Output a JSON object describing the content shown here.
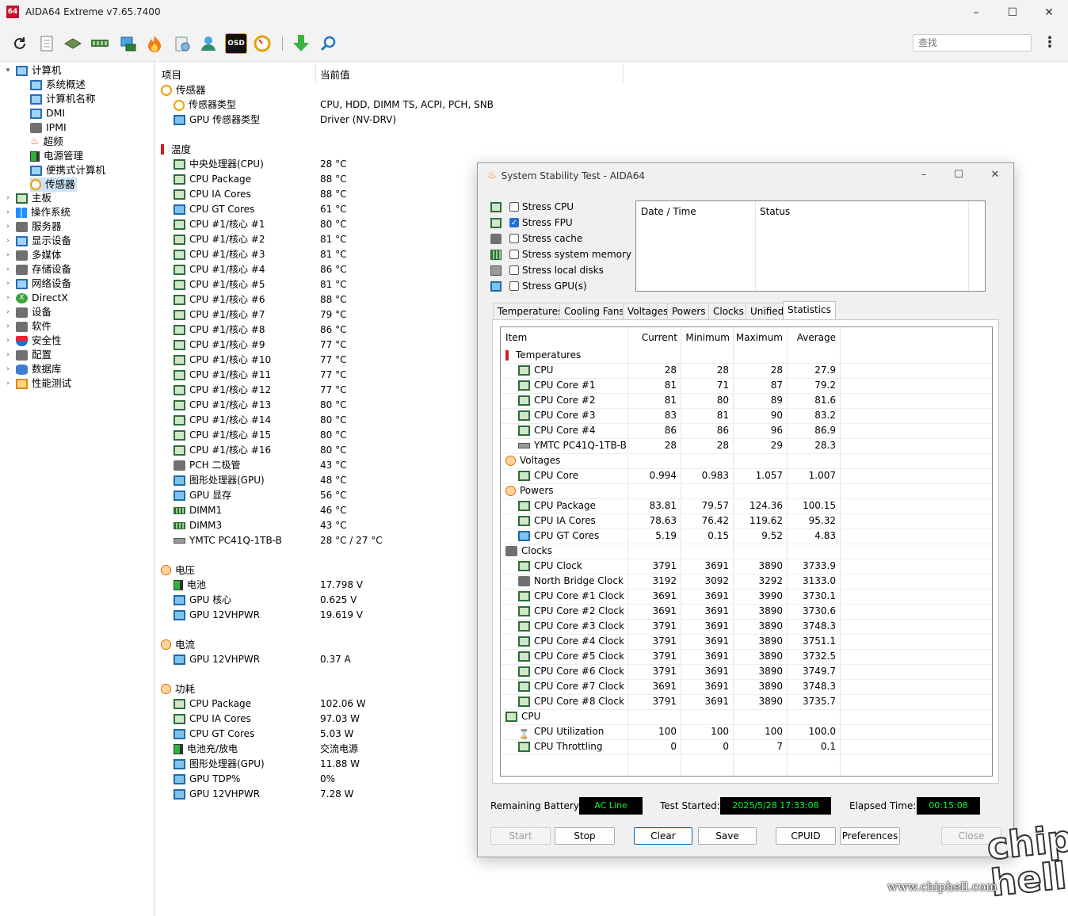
{
  "window": {
    "title": "AIDA64 Extreme v7.65.7400",
    "logo": "64",
    "minimize": "–",
    "maximize": "☐",
    "close": "✕"
  },
  "toolbar": {
    "search_placeholder": "查找",
    "more": "⋮",
    "osd": "OSD"
  },
  "sidebar": {
    "items": [
      {
        "label": "计算机",
        "expanded": true
      },
      {
        "label": "系统概述"
      },
      {
        "label": "计算机名称"
      },
      {
        "label": "DMI"
      },
      {
        "label": "IPMI"
      },
      {
        "label": "超频"
      },
      {
        "label": "电源管理"
      },
      {
        "label": "便携式计算机"
      },
      {
        "label": "传感器",
        "selected": true
      },
      {
        "label": "主板"
      },
      {
        "label": "操作系统"
      },
      {
        "label": "服务器"
      },
      {
        "label": "显示设备"
      },
      {
        "label": "多媒体"
      },
      {
        "label": "存储设备"
      },
      {
        "label": "网络设备"
      },
      {
        "label": "DirectX"
      },
      {
        "label": "设备"
      },
      {
        "label": "软件"
      },
      {
        "label": "安全性"
      },
      {
        "label": "配置"
      },
      {
        "label": "数据库"
      },
      {
        "label": "性能测试"
      }
    ]
  },
  "main": {
    "col_item": "项目",
    "col_value": "当前值",
    "rows": [
      {
        "type": "group",
        "label": "传感器",
        "icon": "gauge"
      },
      {
        "label": "传感器类型",
        "value": "CPU, HDD, DIMM TS, ACPI, PCH, SNB",
        "icon": "gauge"
      },
      {
        "label": "GPU 传感器类型",
        "value": "Driver  (NV-DRV)",
        "icon": "gpu"
      },
      {
        "type": "gap"
      },
      {
        "type": "group",
        "label": "温度",
        "icon": "therm"
      },
      {
        "label": "中央处理器(CPU)",
        "value": "28 °C",
        "icon": "chip"
      },
      {
        "label": "CPU Package",
        "value": "88 °C",
        "icon": "chip"
      },
      {
        "label": "CPU IA Cores",
        "value": "88 °C",
        "icon": "chip"
      },
      {
        "label": "CPU GT Cores",
        "value": "61 °C",
        "icon": "gpu"
      },
      {
        "label": "CPU #1/核心 #1",
        "value": "80 °C",
        "icon": "chip"
      },
      {
        "label": "CPU #1/核心 #2",
        "value": "81 °C",
        "icon": "chip"
      },
      {
        "label": "CPU #1/核心 #3",
        "value": "81 °C",
        "icon": "chip"
      },
      {
        "label": "CPU #1/核心 #4",
        "value": "86 °C",
        "icon": "chip"
      },
      {
        "label": "CPU #1/核心 #5",
        "value": "81 °C",
        "icon": "chip"
      },
      {
        "label": "CPU #1/核心 #6",
        "value": "88 °C",
        "icon": "chip"
      },
      {
        "label": "CPU #1/核心 #7",
        "value": "79 °C",
        "icon": "chip"
      },
      {
        "label": "CPU #1/核心 #8",
        "value": "86 °C",
        "icon": "chip"
      },
      {
        "label": "CPU #1/核心 #9",
        "value": "77 °C",
        "icon": "chip"
      },
      {
        "label": "CPU #1/核心 #10",
        "value": "77 °C",
        "icon": "chip"
      },
      {
        "label": "CPU #1/核心 #11",
        "value": "77 °C",
        "icon": "chip"
      },
      {
        "label": "CPU #1/核心 #12",
        "value": "77 °C",
        "icon": "chip"
      },
      {
        "label": "CPU #1/核心 #13",
        "value": "80 °C",
        "icon": "chip"
      },
      {
        "label": "CPU #1/核心 #14",
        "value": "80 °C",
        "icon": "chip"
      },
      {
        "label": "CPU #1/核心 #15",
        "value": "80 °C",
        "icon": "chip"
      },
      {
        "label": "CPU #1/核心 #16",
        "value": "80 °C",
        "icon": "chip"
      },
      {
        "label": "PCH 二极管",
        "value": "43 °C",
        "icon": "gray"
      },
      {
        "label": "图形处理器(GPU)",
        "value": "48 °C",
        "icon": "gpu"
      },
      {
        "label": "GPU 显存",
        "value": "56 °C",
        "icon": "gpu"
      },
      {
        "label": "DIMM1",
        "value": "46 °C",
        "icon": "dimm"
      },
      {
        "label": "DIMM3",
        "value": "43 °C",
        "icon": "dimm"
      },
      {
        "label": "YMTC PC41Q-1TB-B",
        "value": "28 °C / 27 °C",
        "icon": "disk"
      },
      {
        "type": "gap"
      },
      {
        "type": "group",
        "label": "电压",
        "icon": "bolt"
      },
      {
        "label": "电池",
        "value": "17.798 V",
        "icon": "bat"
      },
      {
        "label": "GPU 核心",
        "value": "0.625 V",
        "icon": "gpu"
      },
      {
        "label": "GPU 12VHPWR",
        "value": "19.619 V",
        "icon": "gpu"
      },
      {
        "type": "gap"
      },
      {
        "type": "group",
        "label": "电流",
        "icon": "bolt"
      },
      {
        "label": "GPU 12VHPWR",
        "value": "0.37 A",
        "icon": "gpu"
      },
      {
        "type": "gap"
      },
      {
        "type": "group",
        "label": "功耗",
        "icon": "bolt"
      },
      {
        "label": "CPU Package",
        "value": "102.06 W",
        "icon": "chip"
      },
      {
        "label": "CPU IA Cores",
        "value": "97.03 W",
        "icon": "chip"
      },
      {
        "label": "CPU GT Cores",
        "value": "5.03 W",
        "icon": "gpu"
      },
      {
        "label": "电池充/放电",
        "value": "交流电源",
        "icon": "bat"
      },
      {
        "label": "图形处理器(GPU)",
        "value": "11.88 W",
        "icon": "gpu"
      },
      {
        "label": "GPU TDP%",
        "value": "0%",
        "icon": "gpu"
      },
      {
        "label": "GPU 12VHPWR",
        "value": "7.28 W",
        "icon": "gpu"
      }
    ]
  },
  "dialog": {
    "title": "System Stability Test - AIDA64",
    "stress": [
      {
        "label": "Stress CPU",
        "checked": false,
        "icon": "chip"
      },
      {
        "label": "Stress FPU",
        "checked": true,
        "icon": "fpu"
      },
      {
        "label": "Stress cache",
        "checked": false,
        "icon": "cache"
      },
      {
        "label": "Stress system memory",
        "checked": false,
        "icon": "dimm"
      },
      {
        "label": "Stress local disks",
        "checked": false,
        "icon": "disk"
      },
      {
        "label": "Stress GPU(s)",
        "checked": false,
        "icon": "gpu"
      }
    ],
    "log": {
      "col_date": "Date / Time",
      "col_status": "Status"
    },
    "tabs": [
      "Temperatures",
      "Cooling Fans",
      "Voltages",
      "Powers",
      "Clocks",
      "Unified",
      "Statistics"
    ],
    "active_tab": "Statistics",
    "stats": {
      "headers": [
        "Item",
        "Current",
        "Minimum",
        "Maximum",
        "Average"
      ],
      "rows": [
        {
          "type": "group",
          "label": "Temperatures",
          "icon": "therm"
        },
        {
          "label": "CPU",
          "icon": "chip",
          "cur": "28",
          "min": "28",
          "max": "28",
          "avg": "27.9"
        },
        {
          "label": "CPU Core #1",
          "icon": "chip",
          "cur": "81",
          "min": "71",
          "max": "87",
          "avg": "79.2"
        },
        {
          "label": "CPU Core #2",
          "icon": "chip",
          "cur": "81",
          "min": "80",
          "max": "89",
          "avg": "81.6"
        },
        {
          "label": "CPU Core #3",
          "icon": "chip",
          "cur": "83",
          "min": "81",
          "max": "90",
          "avg": "83.2"
        },
        {
          "label": "CPU Core #4",
          "icon": "chip",
          "cur": "86",
          "min": "86",
          "max": "96",
          "avg": "86.9"
        },
        {
          "label": "YMTC PC41Q-1TB-B",
          "icon": "disk",
          "cur": "28",
          "min": "28",
          "max": "29",
          "avg": "28.3"
        },
        {
          "type": "group",
          "label": "Voltages",
          "icon": "bolt"
        },
        {
          "label": "CPU Core",
          "icon": "chip",
          "cur": "0.994",
          "min": "0.983",
          "max": "1.057",
          "avg": "1.007"
        },
        {
          "type": "group",
          "label": "Powers",
          "icon": "bolt"
        },
        {
          "label": "CPU Package",
          "icon": "chip",
          "cur": "83.81",
          "min": "79.57",
          "max": "124.36",
          "avg": "100.15"
        },
        {
          "label": "CPU IA Cores",
          "icon": "chip",
          "cur": "78.63",
          "min": "76.42",
          "max": "119.62",
          "avg": "95.32"
        },
        {
          "label": "CPU GT Cores",
          "icon": "gpu",
          "cur": "5.19",
          "min": "0.15",
          "max": "9.52",
          "avg": "4.83"
        },
        {
          "type": "group",
          "label": "Clocks",
          "icon": "cache"
        },
        {
          "label": "CPU Clock",
          "icon": "chip",
          "cur": "3791",
          "min": "3691",
          "max": "3890",
          "avg": "3733.9"
        },
        {
          "label": "North Bridge Clock",
          "icon": "cache",
          "cur": "3192",
          "min": "3092",
          "max": "3292",
          "avg": "3133.0"
        },
        {
          "label": "CPU Core #1 Clock",
          "icon": "chip",
          "cur": "3691",
          "min": "3691",
          "max": "3990",
          "avg": "3730.1"
        },
        {
          "label": "CPU Core #2 Clock",
          "icon": "chip",
          "cur": "3691",
          "min": "3691",
          "max": "3890",
          "avg": "3730.6"
        },
        {
          "label": "CPU Core #3 Clock",
          "icon": "chip",
          "cur": "3791",
          "min": "3691",
          "max": "3890",
          "avg": "3748.3"
        },
        {
          "label": "CPU Core #4 Clock",
          "icon": "chip",
          "cur": "3791",
          "min": "3691",
          "max": "3890",
          "avg": "3751.1"
        },
        {
          "label": "CPU Core #5 Clock",
          "icon": "chip",
          "cur": "3791",
          "min": "3691",
          "max": "3890",
          "avg": "3732.5"
        },
        {
          "label": "CPU Core #6 Clock",
          "icon": "chip",
          "cur": "3791",
          "min": "3691",
          "max": "3890",
          "avg": "3749.7"
        },
        {
          "label": "CPU Core #7 Clock",
          "icon": "chip",
          "cur": "3691",
          "min": "3691",
          "max": "3890",
          "avg": "3748.3"
        },
        {
          "label": "CPU Core #8 Clock",
          "icon": "chip",
          "cur": "3791",
          "min": "3691",
          "max": "3890",
          "avg": "3735.7"
        },
        {
          "type": "group",
          "label": "CPU",
          "icon": "chip"
        },
        {
          "label": "CPU Utilization",
          "icon": "hourglass",
          "cur": "100",
          "min": "100",
          "max": "100",
          "avg": "100.0"
        },
        {
          "label": "CPU Throttling",
          "icon": "chip",
          "cur": "0",
          "min": "0",
          "max": "7",
          "avg": "0.1"
        }
      ]
    },
    "status": {
      "battery_label": "Remaining Battery:",
      "battery_value": "AC Line",
      "started_label": "Test Started:",
      "started_value": "2025/5/28 17:33:08",
      "elapsed_label": "Elapsed Time:",
      "elapsed_value": "00:15:08"
    },
    "buttons": {
      "start": "Start",
      "stop": "Stop",
      "clear": "Clear",
      "save": "Save",
      "cpuid": "CPUID",
      "preferences": "Preferences",
      "close": "Close"
    }
  },
  "watermark": {
    "url": "www.chiphell.com",
    "logo": "chip hell"
  },
  "colors": {
    "accent": "#0067c0",
    "display_bg": "#000000",
    "display_fg": "#00ff30",
    "selection": "#cce4f7"
  }
}
